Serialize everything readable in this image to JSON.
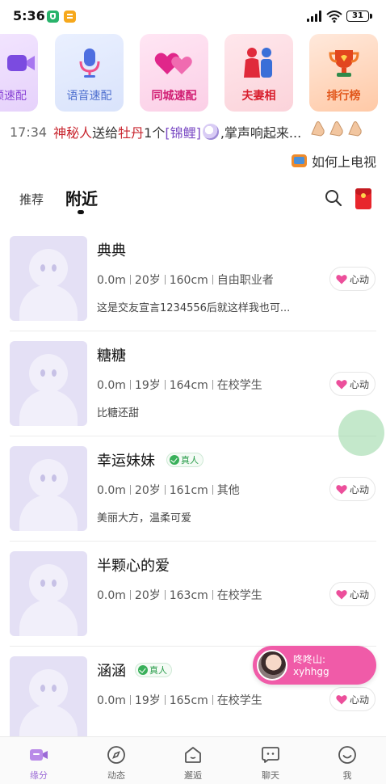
{
  "status_bar": {
    "time": "5:36",
    "battery": "31"
  },
  "quick_actions": [
    {
      "label": "频速配",
      "icon": "video-camera-icon"
    },
    {
      "label": "语音速配",
      "icon": "microphone-icon"
    },
    {
      "label": "同城速配",
      "icon": "hearts-icon"
    },
    {
      "label": "夫妻相",
      "icon": "couple-icon"
    },
    {
      "label": "排行榜",
      "icon": "trophy-icon"
    }
  ],
  "broadcast": {
    "time": "17:34",
    "actor": "神秘人",
    "verb": "送给",
    "target": "牡丹",
    "count": "1个",
    "gift": "[锦鲤]",
    "suffix": ",掌声响起来..."
  },
  "tv_link": "如何上电视",
  "tabs": {
    "recommend": "推荐",
    "nearby": "附近",
    "active": "nearby"
  },
  "users": [
    {
      "name": "典典",
      "verified": false,
      "distance": "0.0m",
      "age": "20岁",
      "height": "160cm",
      "job": "自由职业者",
      "bio": "这是交友宣言1234556后就这样我也可..."
    },
    {
      "name": "糖糖",
      "verified": false,
      "distance": "0.0m",
      "age": "19岁",
      "height": "164cm",
      "job": "在校学生",
      "bio": "比糖还甜"
    },
    {
      "name": "幸运妹妹",
      "verified": true,
      "distance": "0.0m",
      "age": "20岁",
      "height": "161cm",
      "job": "其他",
      "bio": "美丽大方，温柔可爱"
    },
    {
      "name": "半颗心的爱",
      "verified": false,
      "distance": "0.0m",
      "age": "20岁",
      "height": "163cm",
      "job": "在校学生",
      "bio": ""
    },
    {
      "name": "涵涵",
      "verified": true,
      "distance": "0.0m",
      "age": "19岁",
      "height": "165cm",
      "job": "在校学生",
      "bio": ""
    }
  ],
  "verified_label": "真人",
  "like_label": "心动",
  "chat_popup": {
    "name": "咚咚山:",
    "message": "xyhhgg"
  },
  "bottom_nav": [
    {
      "label": "缘分",
      "icon": "video-chat-icon",
      "active": true
    },
    {
      "label": "动态",
      "icon": "compass-icon",
      "active": false
    },
    {
      "label": "邂逅",
      "icon": "house-icon",
      "active": false
    },
    {
      "label": "聊天",
      "icon": "chat-icon",
      "active": false
    },
    {
      "label": "我",
      "icon": "smile-icon",
      "active": false
    }
  ],
  "colors": {
    "accent": "#9b6ad6",
    "pink": "#f05ba8",
    "heart": "#ec4f9b",
    "verified": "#39b05a"
  }
}
